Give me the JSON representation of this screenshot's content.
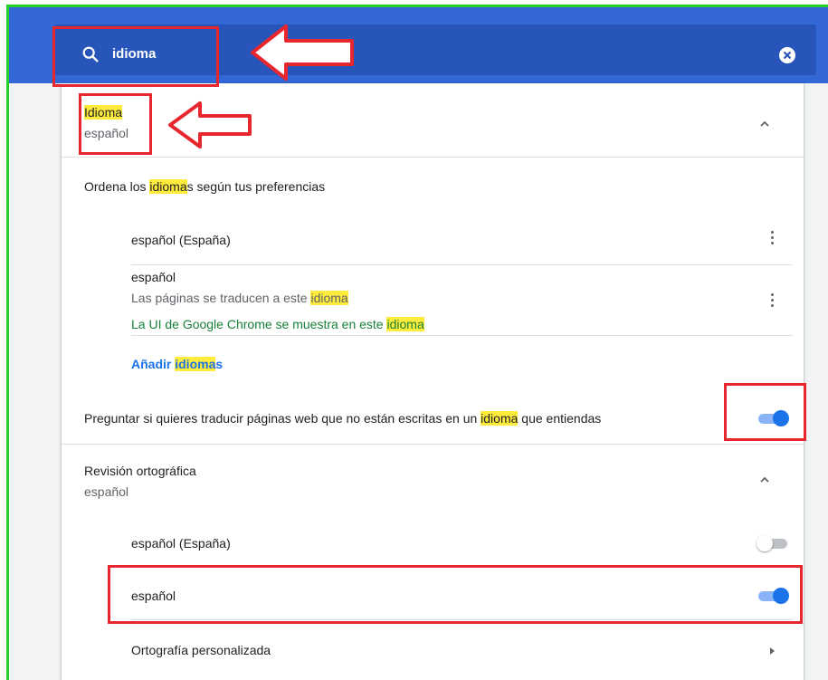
{
  "search": {
    "query": "idioma"
  },
  "language": {
    "title": "Idioma",
    "subtitle": "español",
    "order_text_pre": "Ordena los ",
    "order_text_hl": "idioma",
    "order_text_post": "s según tus preferencias",
    "languages": [
      {
        "name": "español (España)"
      },
      {
        "name": "español",
        "line2_pre": "Las páginas se traducen a este ",
        "line2_hl": "idioma",
        "line3_pre": "La UI de Google Chrome se muestra en este ",
        "line3_hl": "idioma"
      }
    ],
    "add_pre": "Añadir ",
    "add_hl": "idioma",
    "add_post": "s",
    "translate_pre": "Preguntar si quieres traducir páginas web que no están escritas en un ",
    "translate_hl": "idioma",
    "translate_post": " que entiendas",
    "translate_enabled": true
  },
  "spellcheck": {
    "title": "Revisión ortográfica",
    "subtitle": "español",
    "items": [
      {
        "name": "español (España)",
        "enabled": false
      },
      {
        "name": "español",
        "enabled": true
      }
    ],
    "custom_label": "Ortografía personalizada"
  },
  "colors": {
    "header": "#3367d6",
    "accent": "#1a73e8",
    "highlight": "#ffeb3b",
    "annotation": "#e8262d",
    "frame": "#26d026"
  }
}
